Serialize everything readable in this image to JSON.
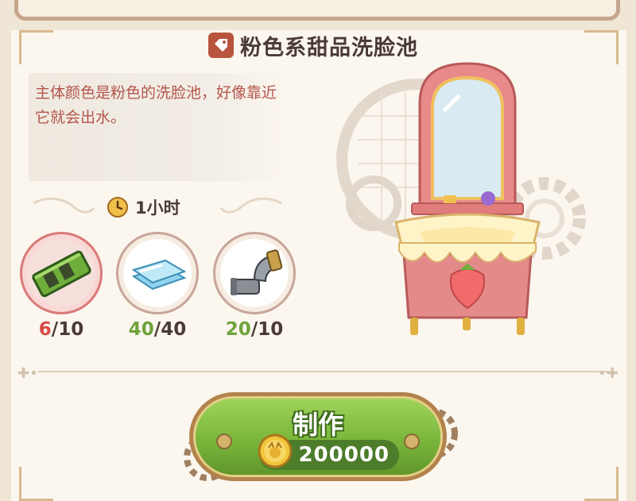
{
  "item": {
    "name": "粉色系甜品洗脸池",
    "description": "主体颜色是粉色的洗脸池，好像靠近它就会出水。",
    "craft_time": "1小时"
  },
  "materials": [
    {
      "icon": "green-board-icon",
      "have": "6",
      "need": "/10",
      "status": "insufficient"
    },
    {
      "icon": "glass-panes-icon",
      "have": "40",
      "need": "/40",
      "status": "sufficient"
    },
    {
      "icon": "pipe-elbow-icon",
      "have": "20",
      "need": "/10",
      "status": "sufficient"
    }
  ],
  "craft_button": {
    "label": "制作",
    "cost": "200000",
    "cost_icon": "gold-coin-icon"
  },
  "colors": {
    "accent_green": "#7ab63b",
    "insufficient": "#d84a45",
    "sufficient": "#6ea23c",
    "title_icon": "#b9543f"
  }
}
